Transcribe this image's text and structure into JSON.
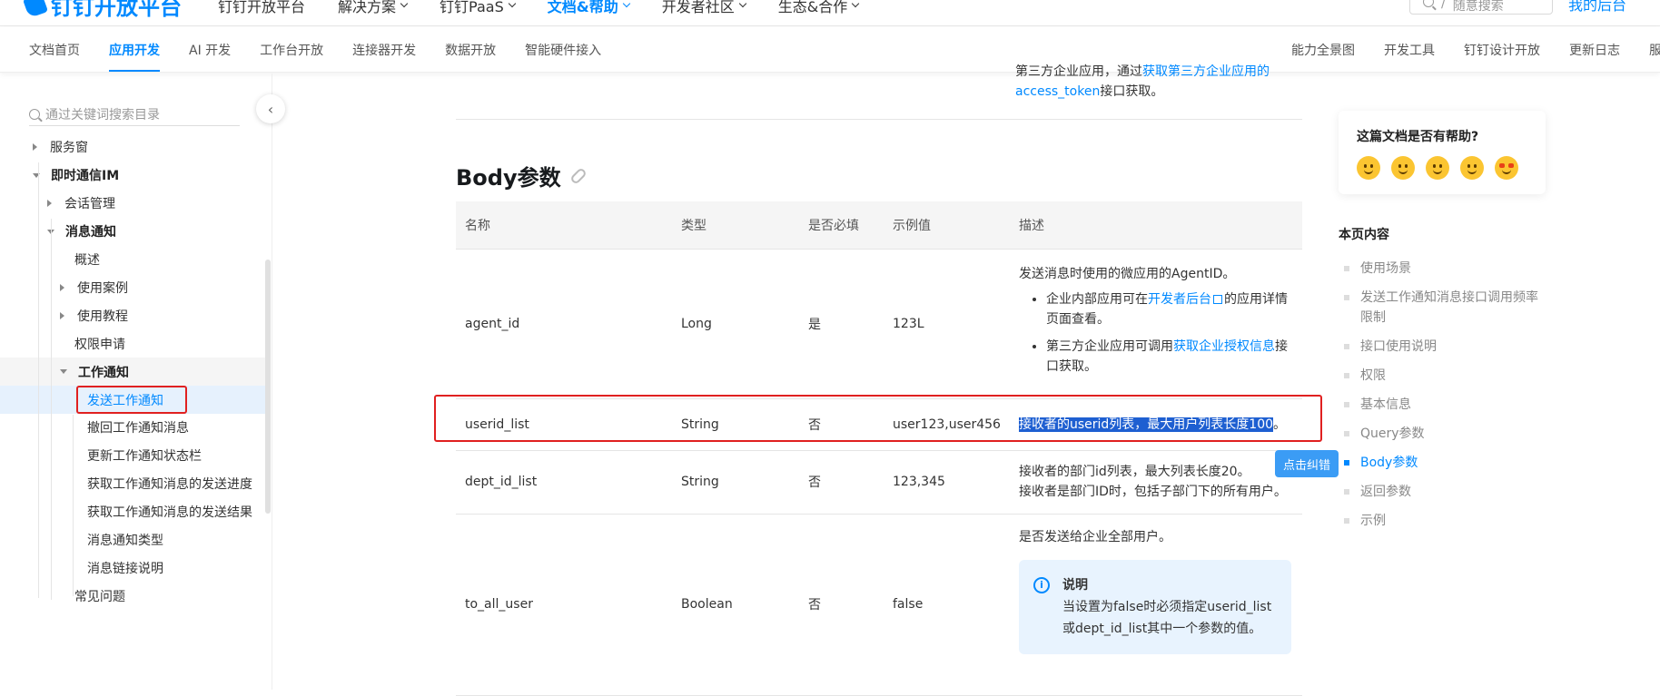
{
  "header": {
    "logo_text": "钉钉开放平台",
    "nav": [
      {
        "label": "钉钉开放平台",
        "dropdown": false,
        "active": false
      },
      {
        "label": "解决方案",
        "dropdown": true,
        "active": false
      },
      {
        "label": "钉钉PaaS",
        "dropdown": true,
        "active": false
      },
      {
        "label": "文档&帮助",
        "dropdown": true,
        "active": true
      },
      {
        "label": "开发者社区",
        "dropdown": true,
        "active": false
      },
      {
        "label": "生态&合作",
        "dropdown": true,
        "active": false
      }
    ],
    "search_placeholder": "随意搜索",
    "right_link": "我的后台"
  },
  "subnav": {
    "left": [
      "文档首页",
      "应用开发",
      "AI 开发",
      "工作台开放",
      "连接器开发",
      "数据开放",
      "智能硬件接入"
    ],
    "active": "应用开发",
    "right": [
      "能力全景图",
      "开发工具",
      "钉钉设计开放",
      "更新日志",
      "服"
    ]
  },
  "sidebar": {
    "search_placeholder": "通过关键词搜索目录",
    "items": [
      {
        "label": "服务窗",
        "level": 1,
        "toggle": "right"
      },
      {
        "label": "即时通信IM",
        "level": 1,
        "toggle": "down",
        "bold": true
      },
      {
        "label": "会话管理",
        "level": 2,
        "toggle": "right"
      },
      {
        "label": "消息通知",
        "level": 2,
        "toggle": "down",
        "bold": true
      },
      {
        "label": "概述",
        "level": 3,
        "toggle": "none"
      },
      {
        "label": "使用案例",
        "level": 3,
        "toggle": "right"
      },
      {
        "label": "使用教程",
        "level": 3,
        "toggle": "right"
      },
      {
        "label": "权限申请",
        "level": 3,
        "toggle": "none"
      },
      {
        "label": "工作通知",
        "level": 3,
        "toggle": "down",
        "bold": true
      },
      {
        "label": "发送工作通知",
        "level": 4,
        "toggle": "none",
        "selected": true
      },
      {
        "label": "撤回工作通知消息",
        "level": 4,
        "toggle": "none"
      },
      {
        "label": "更新工作通知状态栏",
        "level": 4,
        "toggle": "none"
      },
      {
        "label": "获取工作通知消息的发送进度",
        "level": 4,
        "toggle": "none"
      },
      {
        "label": "获取工作通知消息的发送结果",
        "level": 4,
        "toggle": "none"
      },
      {
        "label": "消息通知类型",
        "level": 4,
        "toggle": "none"
      },
      {
        "label": "消息链接说明",
        "level": 4,
        "toggle": "none"
      },
      {
        "label": "常见问题",
        "level": 3,
        "toggle": "none"
      }
    ]
  },
  "content": {
    "prev_text_1": "第三方企业应用，通过",
    "prev_link": "获取第三方企业应用的",
    "prev_link_2": "access_token",
    "prev_text_2": "接口获取。",
    "section_title": "Body参数",
    "table": {
      "headers": [
        "名称",
        "类型",
        "是否必填",
        "示例值",
        "描述"
      ],
      "rows": [
        {
          "name": "agent_id",
          "type": "Long",
          "required": "是",
          "example": "123L",
          "desc": "发送消息时使用的微应用的AgentID。",
          "bullets": [
            {
              "pre": "企业内部应用可在",
              "link": "开发者后台",
              "post": "的应用详情页面查看。"
            },
            {
              "pre": "第三方企业应用可调用",
              "link": "获取企业授权信息",
              "post": "接口获取。"
            }
          ]
        },
        {
          "name": "userid_list",
          "type": "String",
          "required": "否",
          "example": "user123,user456",
          "desc_selected": "接收者的userid列表，最大用户列表长度100",
          "desc_tail": "。"
        },
        {
          "name": "dept_id_list",
          "type": "String",
          "required": "否",
          "example": "123,345",
          "desc_line1": "接收者的部门id列表，最大列表长度20。",
          "desc_line2": "接收者是部门ID时，包括子部门下的所有用户。"
        },
        {
          "name": "to_all_user",
          "type": "Boolean",
          "required": "否",
          "example": "false",
          "desc": "是否发送给企业全部用户。",
          "note_title": "说明",
          "note_text": "当设置为false时必须指定userid_list或dept_id_list其中一个参数的值。"
        }
      ]
    },
    "fix_button": "点击纠错"
  },
  "right_panel": {
    "help_question": "这篇文档是否有帮助?",
    "toc_title": "本页内容",
    "toc": [
      "使用场景",
      "发送工作通知消息接口调用频率限制",
      "接口使用说明",
      "权限",
      "基本信息",
      "Query参数",
      "Body参数",
      "返回参数",
      "示例"
    ],
    "toc_active": "Body参数"
  },
  "colors": {
    "accent": "#0089ff",
    "highlight_border": "#e02020",
    "selection": "#1e5fd1"
  }
}
